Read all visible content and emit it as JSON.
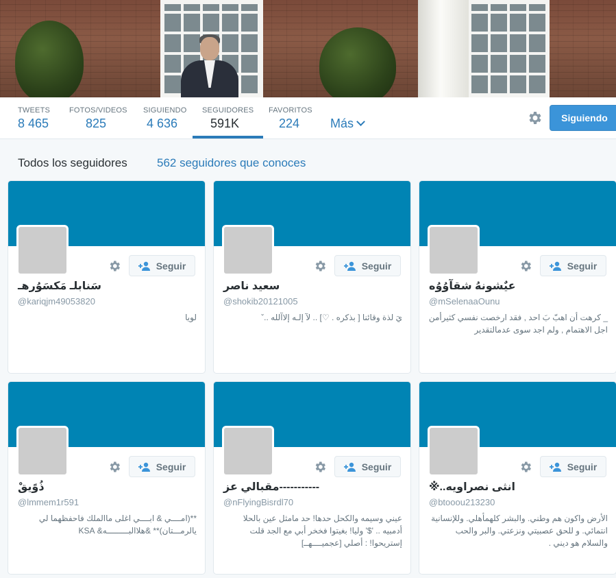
{
  "profile_nav": {
    "stats": [
      {
        "label": "TWEETS",
        "value": "8 465"
      },
      {
        "label": "FOTOS/VIDEOS",
        "value": "825"
      },
      {
        "label": "SIGUIENDO",
        "value": "4 636"
      },
      {
        "label": "SEGUIDORES",
        "value": "591K"
      },
      {
        "label": "FAVORITOS",
        "value": "224"
      }
    ],
    "active_tab": "SEGUIDORES",
    "more_label": "Más",
    "follow_state_label": "Siguiendo"
  },
  "section": {
    "title": "Todos los seguidores",
    "known_link": "562 seguidores que conoces"
  },
  "cards": [
    {
      "name": "سَنابلـ مَكسَوُرهـ",
      "handle": "@kariqjm49053820",
      "bio": "لويا",
      "follow_label": "Seguir"
    },
    {
      "name": "سعيد ناصر",
      "handle": "@shokib20121005",
      "bio": "يَ لذة وقائنا [ بذكره . ♡] .. لآ إلـه إلاآلله ..ˇ",
      "follow_label": "Seguir"
    },
    {
      "name": "عيٌشونهُ شقآوُوُه",
      "handle": "@mSelenaaOunu",
      "bio": "_ كرهت أن اهبّ بَ احد , فقد ارخصت نفسي كثيرأمن اجل الاهتمام , ولم اجد سوى عدمالتقدير",
      "follow_label": "Seguir"
    },
    {
      "name": "ذُوًيقْ",
      "handle": "@lmmem1r591",
      "bio": "**(امــــي & ابــــي اغلى ماالملك فاحفظهما لي يالرمـــتان)** &هلاالبـــــــــه& KSA",
      "follow_label": "Seguir"
    },
    {
      "name": "مقبالي عز-----------",
      "handle": "@nFlyingBisrdl70",
      "bio": "عيني وسيمه والكحل حدها! حد مامثل عين بالحلا أدمبيه .. '$' وليا! بغيتوا فخخر أبي مع الجد قلت إستريحوا! : أصلي [عجميــــهــ]",
      "follow_label": "Seguir"
    },
    {
      "name": "※..انثى نصراويه",
      "handle": "@btooou213230",
      "bio": "الأرض واكون هم وطني. والبشر كلهمأهلي. وللإنسانية انتمائي. و للحق عصبيتي ونزعتي. والبر والحب والسلام هو ديني .",
      "follow_label": "Seguir"
    }
  ]
}
